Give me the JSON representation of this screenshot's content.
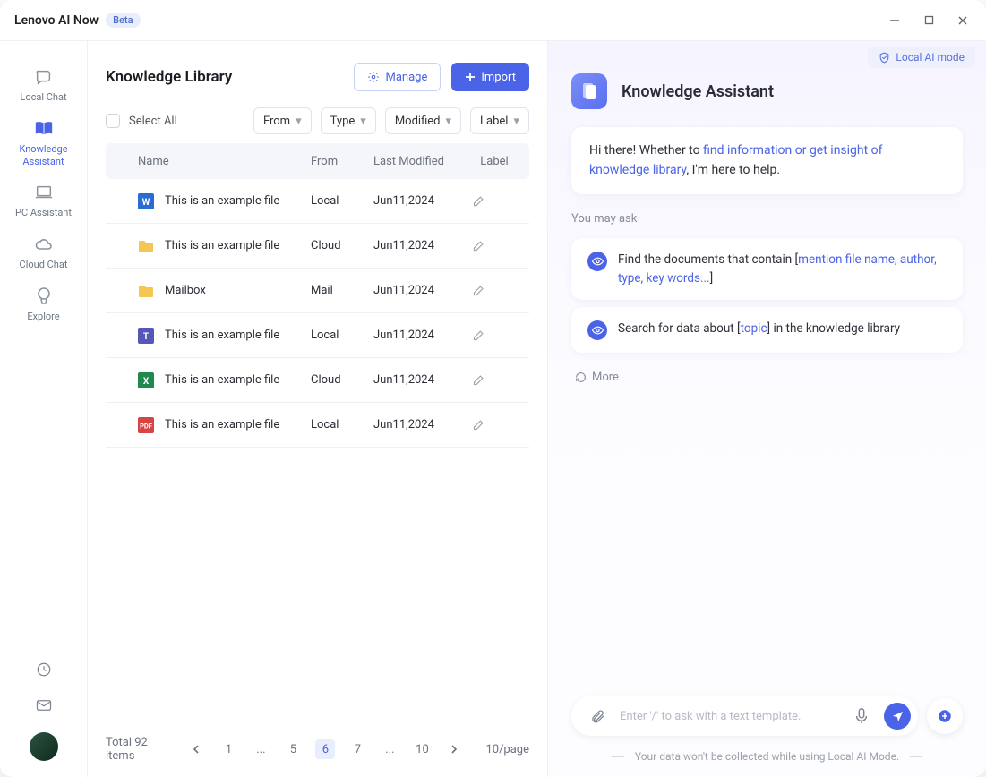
{
  "app": {
    "title": "Lenovo AI Now",
    "badge": "Beta"
  },
  "sidebar": {
    "items": [
      {
        "label": "Local Chat"
      },
      {
        "label": "Knowledge Assistant"
      },
      {
        "label": "PC Assistant"
      },
      {
        "label": "Cloud Chat"
      },
      {
        "label": "Explore"
      }
    ]
  },
  "library": {
    "title": "Knowledge Library",
    "manage_label": "Manage",
    "import_label": "Import",
    "select_all_label": "Select All",
    "filters": {
      "from": "From",
      "type": "Type",
      "modified": "Modified",
      "label": "Label"
    },
    "columns": {
      "name": "Name",
      "from": "From",
      "modified": "Last Modified",
      "label": "Label"
    },
    "rows": [
      {
        "name": "This is an example file",
        "from": "Local",
        "modified": "Jun11,2024",
        "icon": "word"
      },
      {
        "name": "This is an example file",
        "from": "Cloud",
        "modified": "Jun11,2024",
        "icon": "folder"
      },
      {
        "name": "Mailbox",
        "from": "Mail",
        "modified": "Jun11,2024",
        "icon": "folder"
      },
      {
        "name": "This is an example file",
        "from": "Local",
        "modified": "Jun11,2024",
        "icon": "teams"
      },
      {
        "name": "This is an example file",
        "from": "Cloud",
        "modified": "Jun11,2024",
        "icon": "excel"
      },
      {
        "name": "This is an example file",
        "from": "Local",
        "modified": "Jun11,2024",
        "icon": "pdf"
      }
    ],
    "pagination": {
      "total_text": "Total 92 items",
      "pages": [
        "1",
        "...",
        "5",
        "6",
        "7",
        "...",
        "10"
      ],
      "active_index": 3,
      "per_page": "10/page"
    }
  },
  "assistant": {
    "mode_chip": "Local AI mode",
    "title": "Knowledge Assistant",
    "greeting_pre": "Hi there!  Whether to ",
    "greeting_link": "find information or get insight of knowledge library",
    "greeting_post": ", I'm here to help.",
    "you_may_ask": "You may ask",
    "suggestions": [
      {
        "pre": "Find the documents that contain [",
        "ph": "mention file name, author, type, key words...",
        "post": "]"
      },
      {
        "pre": "Search for data about [",
        "ph": "topic",
        "post": "] in the knowledge library"
      }
    ],
    "more_label": "More",
    "input_placeholder": "Enter '/' to ask with a text template.",
    "disclaimer": "Your data won't be collected while using  Local AI Mode."
  }
}
